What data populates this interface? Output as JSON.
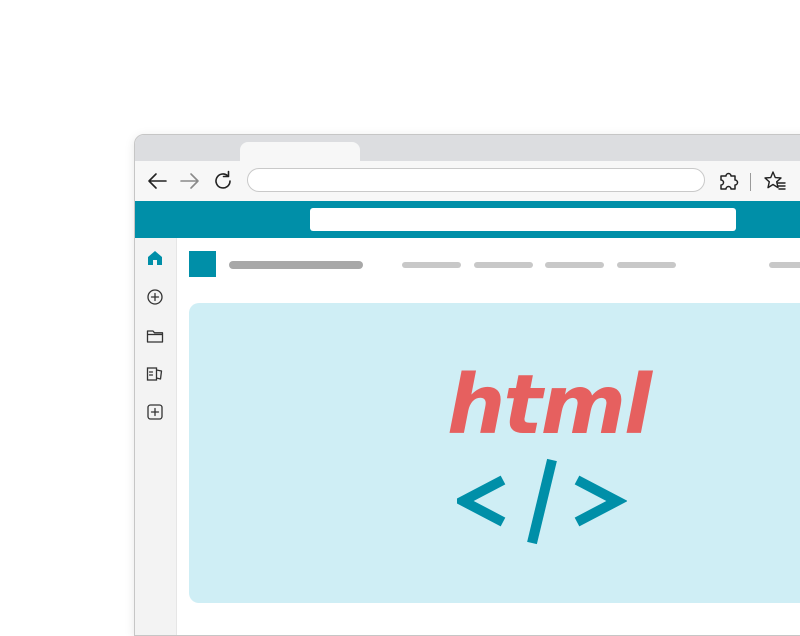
{
  "browser": {
    "tab": {
      "title": ""
    },
    "toolbar": {
      "address_value": "",
      "icons": [
        "back-arrow-icon",
        "forward-arrow-icon",
        "refresh-icon",
        "extensions-icon",
        "favorites-icon"
      ]
    }
  },
  "site": {
    "search_value": "",
    "sidebar": {
      "items": [
        "home-icon",
        "add-circle-icon",
        "folder-icon",
        "collections-icon",
        "add-square-icon"
      ]
    },
    "header": {
      "nav_items": [
        "",
        "",
        "",
        "",
        ""
      ]
    },
    "hero": {
      "title": "html",
      "code_glyph": "</>",
      "title_color": "#e6605f",
      "code_color": "#008fa8"
    }
  },
  "colors": {
    "accent": "#008fa8",
    "hero_background": "#cfeef5",
    "tabstrip": "#dcdde0"
  }
}
